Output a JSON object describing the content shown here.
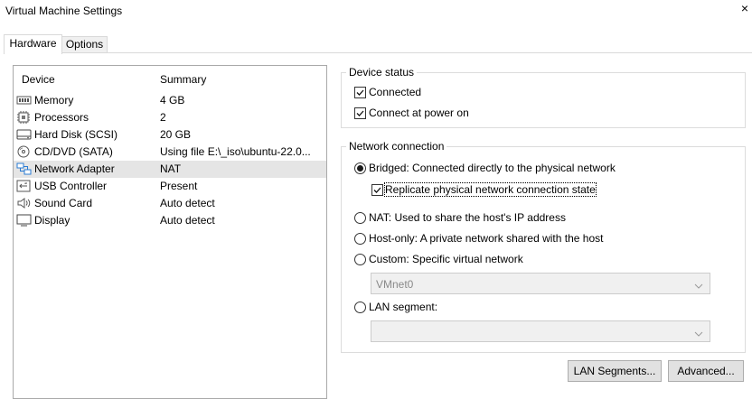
{
  "window": {
    "title": "Virtual Machine Settings",
    "close": "×"
  },
  "tabs": [
    {
      "label": "Hardware"
    },
    {
      "label": "Options"
    }
  ],
  "devices": {
    "header_device": "Device",
    "header_summary": "Summary",
    "rows": [
      {
        "name": "Memory",
        "summary": "4 GB",
        "icon": "memory-icon"
      },
      {
        "name": "Processors",
        "summary": "2",
        "icon": "processor-icon"
      },
      {
        "name": "Hard Disk (SCSI)",
        "summary": "20 GB",
        "icon": "hard-disk-icon"
      },
      {
        "name": "CD/DVD (SATA)",
        "summary": "Using file E:\\_iso\\ubuntu-22.0...",
        "icon": "cd-dvd-icon"
      },
      {
        "name": "Network Adapter",
        "summary": "NAT",
        "icon": "network-adapter-icon",
        "selected": true
      },
      {
        "name": "USB Controller",
        "summary": "Present",
        "icon": "usb-icon"
      },
      {
        "name": "Sound Card",
        "summary": "Auto detect",
        "icon": "speaker-icon"
      },
      {
        "name": "Display",
        "summary": "Auto detect",
        "icon": "monitor-icon"
      }
    ]
  },
  "device_status": {
    "title": "Device status",
    "connected_label": "Connected",
    "connected_checked": true,
    "power_on_label": "Connect at power on",
    "power_on_checked": true
  },
  "network_connection": {
    "title": "Network connection",
    "bridged_label": "Bridged: Connected directly to the physical network",
    "replicate_label": "Replicate physical network connection state",
    "replicate_checked": true,
    "nat_label": "NAT: Used to share the host's IP address",
    "host_only_label": "Host-only: A private network shared with the host",
    "custom_label": "Custom: Specific virtual network",
    "custom_value": "VMnet0",
    "lan_label": "LAN segment:",
    "lan_value": "",
    "selected": "bridged"
  },
  "buttons": {
    "lan_segments": "LAN Segments...",
    "advanced": "Advanced..."
  },
  "colors": {
    "selection": "#e5e5e5",
    "icon_blue": "#2b7cd3",
    "disabled_text": "#8a8a8a"
  }
}
